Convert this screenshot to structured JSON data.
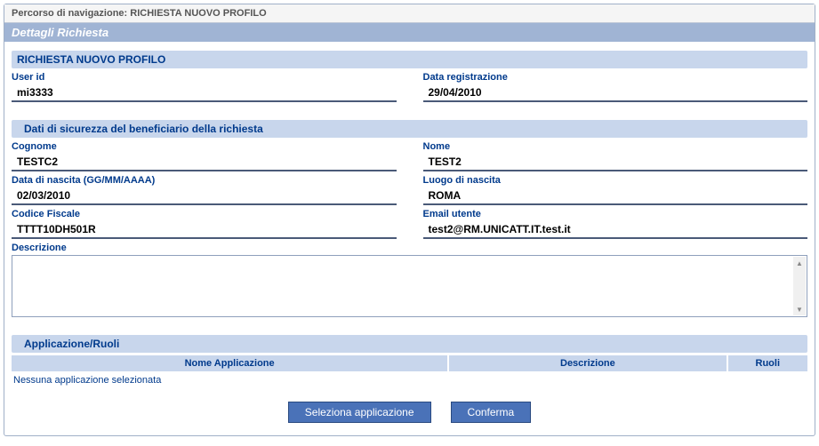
{
  "breadcrumb": {
    "prefix": "Percorso di navigazione:",
    "path": " RICHIESTA NUOVO PROFILO"
  },
  "page_title": "Dettagli Richiesta",
  "section_main": "RICHIESTA NUOVO PROFILO",
  "userid": {
    "label": "User id",
    "value": "mi3333"
  },
  "datareg": {
    "label": "Data registrazione",
    "value": "29/04/2010"
  },
  "section_security": "Dati di sicurezza del beneficiario della richiesta",
  "cognome": {
    "label": "Cognome",
    "value": "TESTC2"
  },
  "nome": {
    "label": "Nome",
    "value": "TEST2"
  },
  "dob": {
    "label": "Data di nascita (GG/MM/AAAA)",
    "value": "02/03/2010"
  },
  "luogo": {
    "label": "Luogo di nascita",
    "value": "ROMA"
  },
  "cf": {
    "label": "Codice Fiscale",
    "value": "TTTT10DH501R"
  },
  "email": {
    "label": "Email utente",
    "value": "test2@RM.UNICATT.IT.test.it"
  },
  "descrizione_label": "Descrizione",
  "section_app": "Applicazione/Ruoli",
  "table": {
    "headers": {
      "name": "Nome Applicazione",
      "desc": "Descrizione",
      "roles": "Ruoli"
    },
    "empty": "Nessuna applicazione selezionata"
  },
  "buttons": {
    "select": "Seleziona applicazione",
    "confirm": "Conferma"
  }
}
